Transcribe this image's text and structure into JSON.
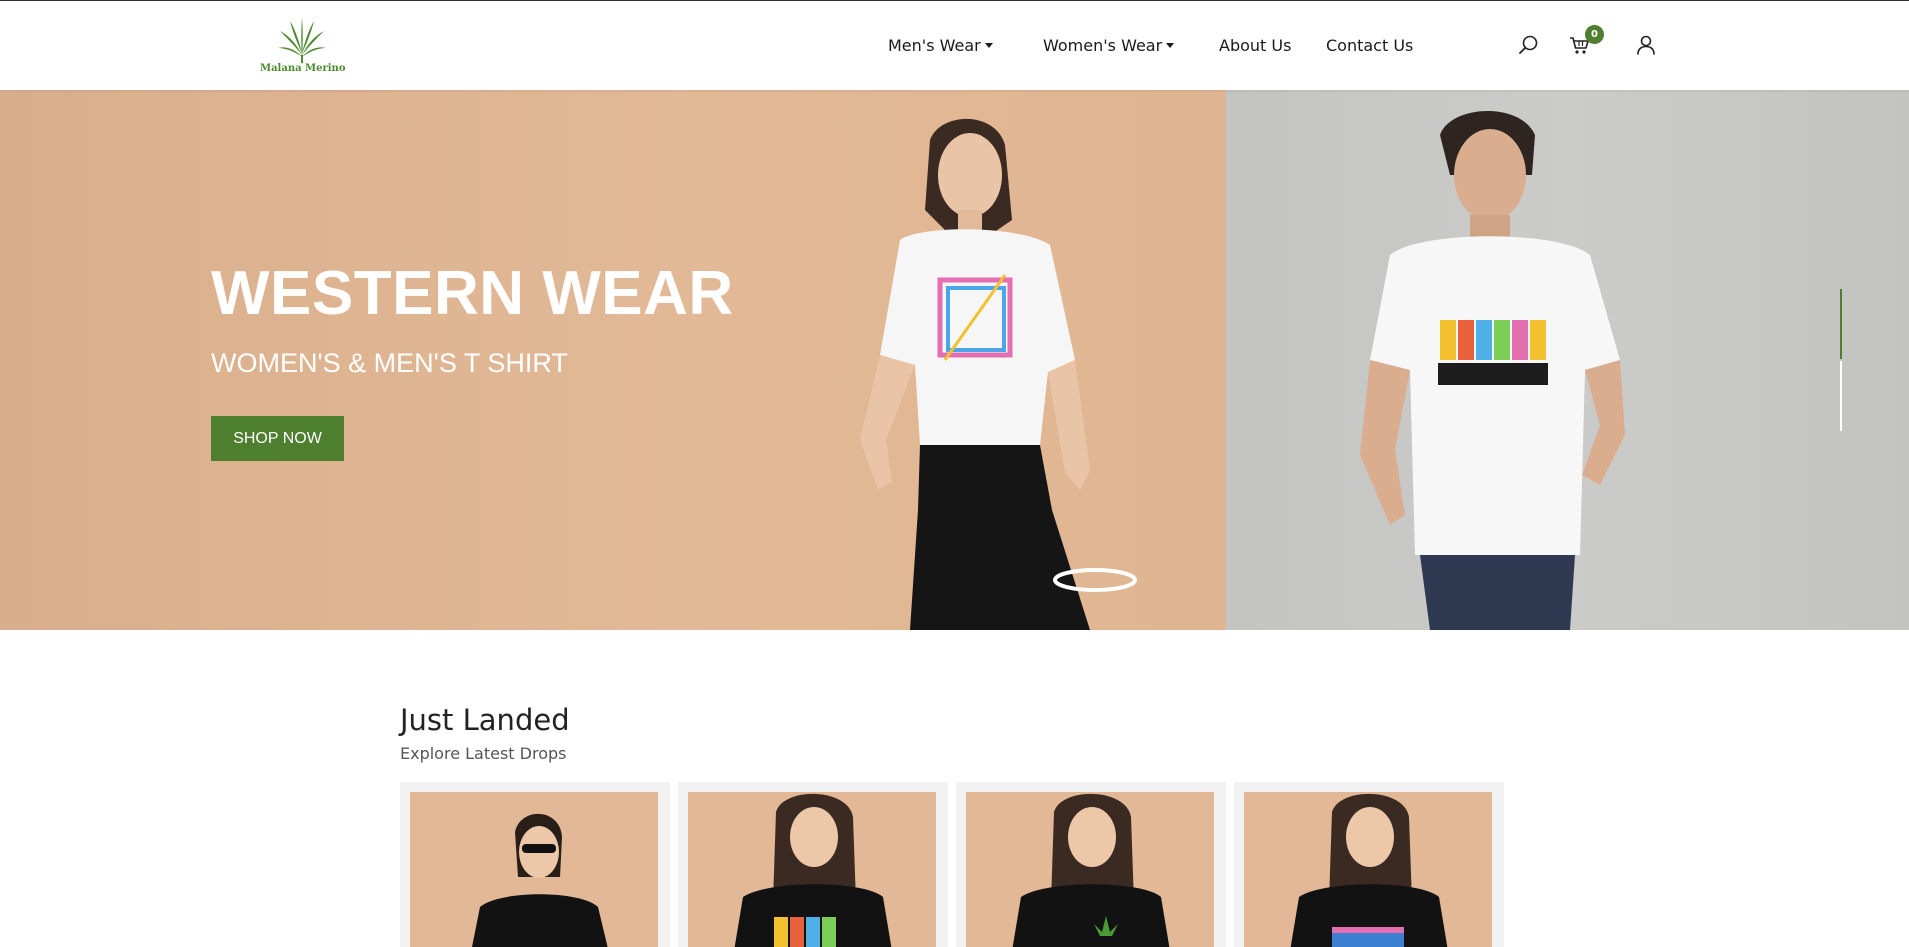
{
  "brand": {
    "logo_text": "Malana Merino",
    "accent_color": "#4d7f2e"
  },
  "nav": {
    "items": [
      {
        "label": "Men's Wear",
        "dropdown": true
      },
      {
        "label": "Women's Wear",
        "dropdown": true
      },
      {
        "label": "About Us",
        "dropdown": false
      },
      {
        "label": "Contact Us",
        "dropdown": false
      }
    ],
    "icons": [
      "search-icon",
      "cart-icon",
      "user-icon"
    ],
    "cart_count": "0"
  },
  "hero": {
    "title": "WESTERN WEAR",
    "subtitle": "WOMEN'S & MEN'S T SHIRT",
    "button_label": "SHOP NOW",
    "active_slide": 1,
    "slide_count": 2
  },
  "just_landed": {
    "title": "Just Landed",
    "subtitle": "Explore Latest Drops",
    "product_count": 4
  }
}
